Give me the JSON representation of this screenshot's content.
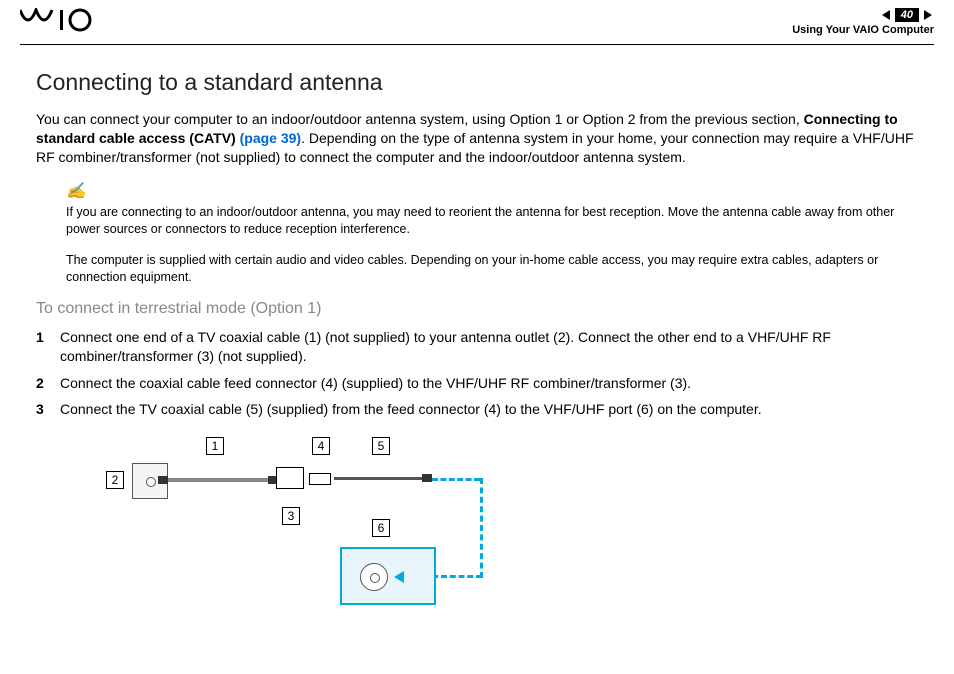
{
  "header": {
    "logo": "VAIO",
    "page_number": "40",
    "section": "Using Your VAIO Computer"
  },
  "title": "Connecting to a standard antenna",
  "intro": {
    "p1a": "You can connect your computer to an indoor/outdoor antenna system, using Option 1 or Option 2 from the previous section, ",
    "p1b": "Connecting to standard cable access (CATV)",
    "p1link": " (page 39)",
    "p1c": ". Depending on the type of antenna system in your home, your connection may require a VHF/UHF RF combiner/transformer (not supplied) to connect the computer and the indoor/outdoor antenna system."
  },
  "note": {
    "text1": "If you are connecting to an indoor/outdoor antenna, you may need to reorient the antenna for best reception. Move the antenna cable away from other power sources or connectors to reduce reception interference.",
    "text2": "The computer is supplied with certain audio and video cables. Depending on your in-home cable access, you may require extra cables, adapters or connection equipment."
  },
  "subhead": "To connect in terrestrial mode (Option 1)",
  "steps": [
    {
      "num": "1",
      "text": "Connect one end of a TV coaxial cable (1) (not supplied) to your antenna outlet (2). Connect the other end to a VHF/UHF RF combiner/transformer (3) (not supplied)."
    },
    {
      "num": "2",
      "text": "Connect the coaxial cable feed connector (4) (supplied) to the VHF/UHF RF combiner/transformer (3)."
    },
    {
      "num": "3",
      "text": "Connect the TV coaxial cable (5) (supplied) from the feed connector (4) to the VHF/UHF port (6) on the computer."
    }
  ],
  "diagram": {
    "labels": {
      "l1": "1",
      "l2": "2",
      "l3": "3",
      "l4": "4",
      "l5": "5",
      "l6": "6"
    }
  }
}
